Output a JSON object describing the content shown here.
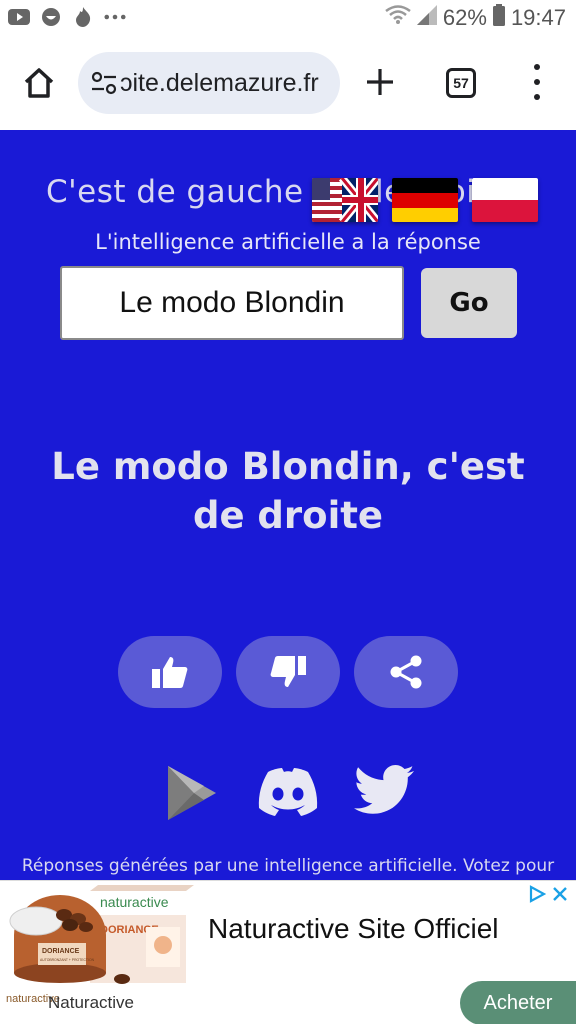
{
  "status_bar": {
    "battery": "62%",
    "time": "19:47",
    "left_icons": [
      "youtube-icon",
      "smiley-icon",
      "flame-icon",
      "more-dots-icon"
    ]
  },
  "browser": {
    "url": "ɔite.delemazure.fr",
    "tab_count": "57"
  },
  "page": {
    "background_color": "#1a1ad6",
    "title": "C'est de gauche ou de droite",
    "title_visible": "C'est de gauche",
    "subtitle": "L'intelligence artificielle a la réponse",
    "search_value": "Le modo Blondin",
    "go_label": "Go",
    "answer": "Le modo Blondin, c'est de droite",
    "vote_buttons": [
      "thumbs-up-icon",
      "thumbs-down-icon",
      "share-icon"
    ],
    "social_links": [
      "google-play-icon",
      "discord-icon",
      "twitter-icon"
    ],
    "disclaimer": "Réponses générées par une intelligence artificielle. Votez pour"
  },
  "ad": {
    "title": "Naturactive Site Officiel",
    "brand": "Naturactive",
    "cta": "Acheter",
    "cta_color": "#5a8f76",
    "product_brand": "naturactive",
    "product_name": "DORIANCE",
    "product_sub": "AUTOBRONZANT + PROTECTION"
  }
}
